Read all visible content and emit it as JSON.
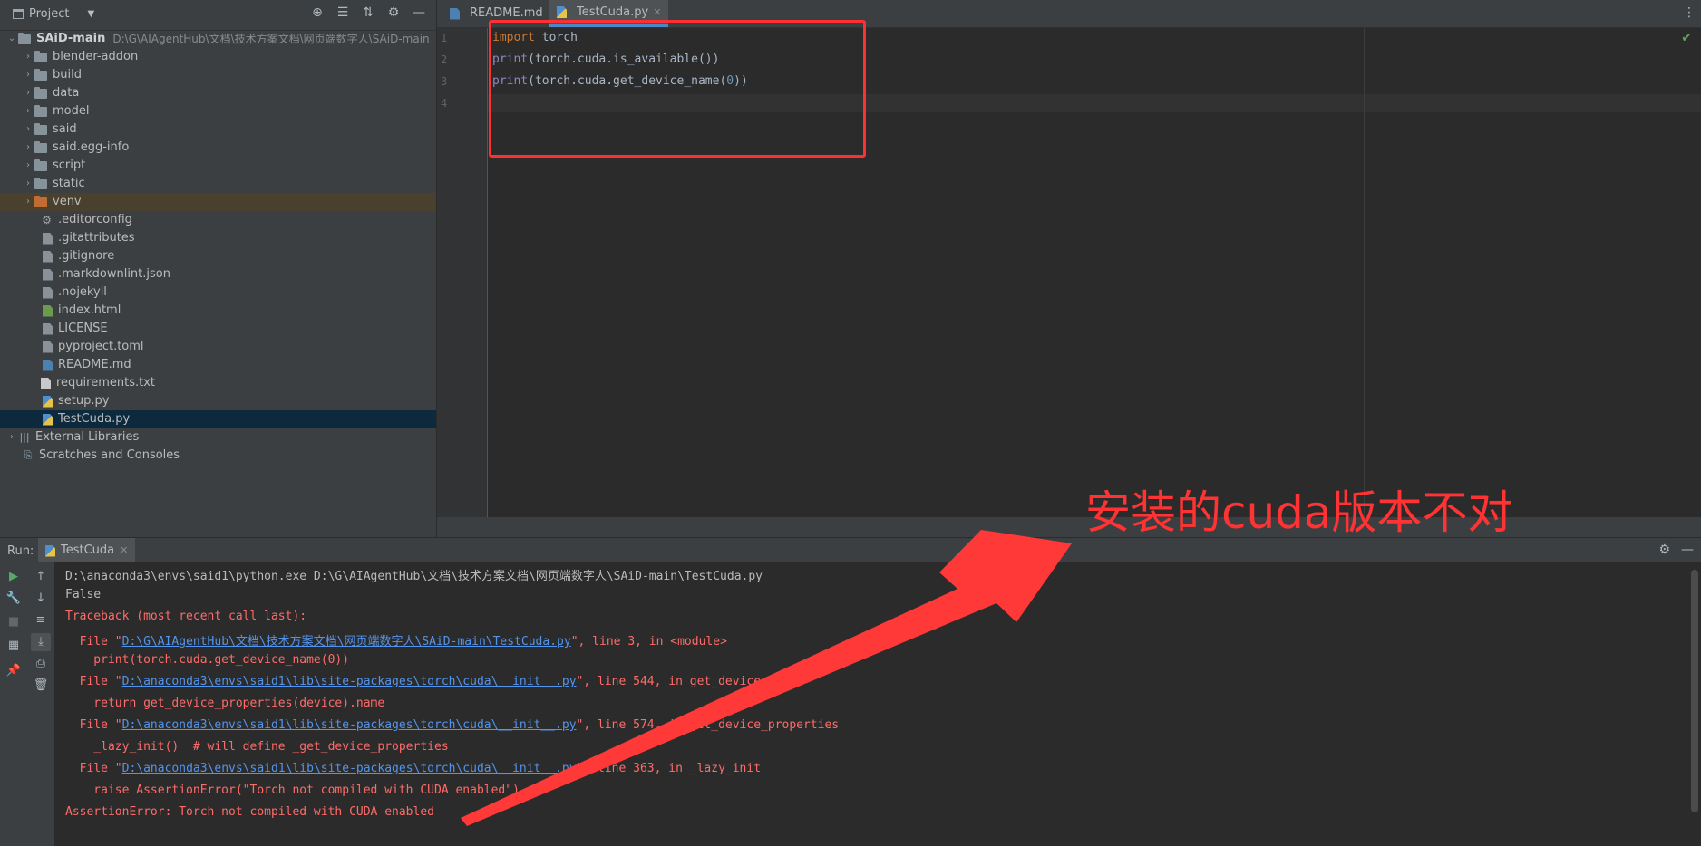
{
  "project_panel": {
    "title": "Project",
    "root": {
      "name": "SAiD-main",
      "path": "D:\\G\\AIAgentHub\\文档\\技术方案文档\\网页端数字人\\SAiD-main"
    },
    "folders": [
      "blender-addon",
      "build",
      "data",
      "model",
      "said",
      "said.egg-info",
      "script",
      "static",
      "venv"
    ],
    "files": [
      ".editorconfig",
      ".gitattributes",
      ".gitignore",
      ".markdownlint.json",
      ".nojekyll",
      "index.html",
      "LICENSE",
      "pyproject.toml",
      "README.md",
      "requirements.txt",
      "setup.py",
      "TestCuda.py"
    ],
    "extras": [
      "External Libraries",
      "Scratches and Consoles"
    ]
  },
  "editor": {
    "tabs": [
      "README.md",
      "TestCuda.py"
    ],
    "line_numbers": [
      "1",
      "2",
      "3",
      "4"
    ],
    "code": {
      "l1_kw": "import",
      "l1_rest": " torch",
      "l2_fn": "print",
      "l2_rest": "(torch.cuda.is_available())",
      "l3_fn": "print",
      "l3_a": "(torch.cuda.get_device_name(",
      "l3_num": "0",
      "l3_b": "))"
    }
  },
  "run": {
    "label": "Run:",
    "tab": "TestCuda",
    "console": {
      "cmd": "D:\\anaconda3\\envs\\said1\\python.exe D:\\G\\AIAgentHub\\文档\\技术方案文档\\网页端数字人\\SAiD-main\\TestCuda.py",
      "false": "False",
      "traceback": "Traceback (most recent call last):",
      "f1_pre": "  File \"",
      "f1_link": "D:\\G\\AIAgentHub\\文档\\技术方案文档\\网页端数字人\\SAiD-main\\TestCuda.py",
      "f1_post": "\", line 3, in <module>",
      "f1_code": "    print(torch.cuda.get_device_name(0))",
      "f2_pre": "  File \"",
      "f2_link": "D:\\anaconda3\\envs\\said1\\lib\\site-packages\\torch\\cuda\\__init__.py",
      "f2_post": "\", line 544, in get_device_name",
      "f2_code": "    return get_device_properties(device).name",
      "f3_pre": "  File \"",
      "f3_link": "D:\\anaconda3\\envs\\said1\\lib\\site-packages\\torch\\cuda\\__init__.py",
      "f3_post": "\", line 574, in get_device_properties",
      "f3_code": "    _lazy_init()  # will define _get_device_properties",
      "f4_pre": "  File \"",
      "f4_link": "D:\\anaconda3\\envs\\said1\\lib\\site-packages\\torch\\cuda\\__init__.py",
      "f4_post": "\", line 363, in _lazy_init",
      "f4_code": "    raise AssertionError(\"Torch not compiled with CUDA enabled\")",
      "final": "AssertionError: Torch not compiled with CUDA enabled"
    }
  },
  "annotation": {
    "text": "安装的cuda版本不对",
    "color": "#ff3333"
  },
  "colors": {
    "accent": "#4a88c7",
    "error": "#ff6b68",
    "link": "#5394ec",
    "keyword": "#cc7832"
  }
}
